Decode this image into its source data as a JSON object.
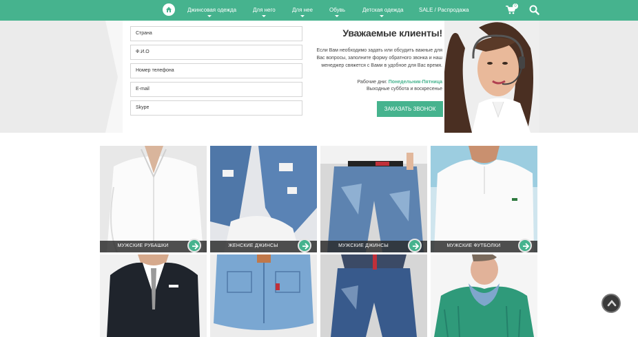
{
  "nav": {
    "items": [
      {
        "label": "Джинсовая одежда",
        "has_dropdown": true
      },
      {
        "label": "Для него",
        "has_dropdown": true
      },
      {
        "label": "Для нее",
        "has_dropdown": true
      },
      {
        "label": "Обувь",
        "has_dropdown": true
      },
      {
        "label": "Детская одежда",
        "has_dropdown": true
      },
      {
        "label": "SALE / Распродажа",
        "has_dropdown": false
      }
    ],
    "cart_count": "0",
    "icons": {
      "home": "home-icon",
      "cart": "cart-icon",
      "search": "search-icon"
    }
  },
  "callback_form": {
    "placeholders": [
      "Страна",
      "Ф.И.О",
      "Номер телефона",
      "E-mail",
      "Skype"
    ],
    "title": "Уважаемые клиенты!",
    "text": "Если Вам необходимо задать или обсудить важные для Вас вопросы, заполните форму обратного звонка и наш менеджер свяжется с Вами в удобное для Вас время.",
    "hours_prefix": "Рабочие дни:",
    "hours_days": "Понедельник-Пятница",
    "hours_weekend": "Выходные суббота и воскресенье",
    "button_label": "ЗАКАЗАТЬ ЗВОНОК"
  },
  "categories": [
    {
      "label": "МУЖСКИЕ РУБАШКИ"
    },
    {
      "label": "ЖЕНСКИЕ ДЖИНСЫ"
    },
    {
      "label": "МУЖСКИЕ ДЖИНСЫ"
    },
    {
      "label": "МУЖСКИЕ ФУТБОЛКИ"
    }
  ],
  "theme": {
    "accent": "#46b38e",
    "dark": "#2a2a2a",
    "light_bg": "#ebebeb"
  }
}
